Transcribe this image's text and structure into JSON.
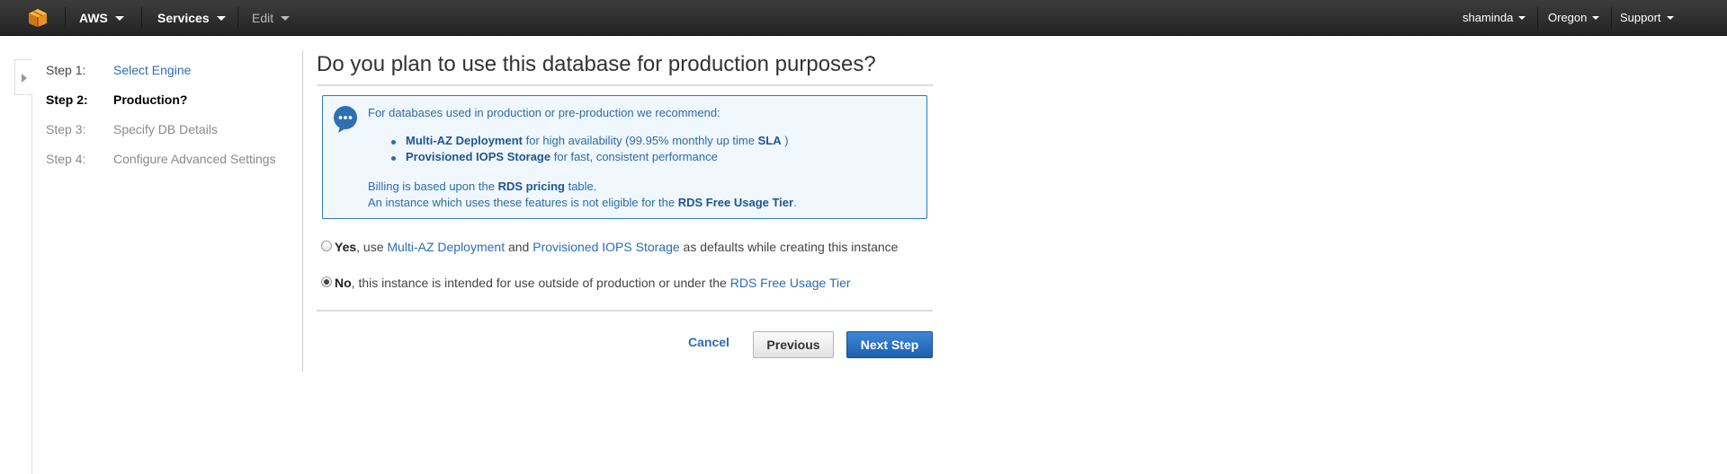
{
  "topnav": {
    "brand": "AWS",
    "services": "Services",
    "edit": "Edit",
    "user": "shaminda",
    "region": "Oregon",
    "support": "Support"
  },
  "steps": [
    {
      "num": "Step 1:",
      "label": "Select Engine",
      "state": "done"
    },
    {
      "num": "Step 2:",
      "label": "Production?",
      "state": "active"
    },
    {
      "num": "Step 3:",
      "label": "Specify DB Details",
      "state": "future"
    },
    {
      "num": "Step 4:",
      "label": "Configure Advanced Settings",
      "state": "future"
    }
  ],
  "main": {
    "title": "Do you plan to use this database for production purposes?",
    "info": {
      "intro": "For databases used in production or pre-production we recommend:",
      "bullet1_strong": "Multi-AZ Deployment",
      "bullet1_text": "for high availability (99.95% monthly up time",
      "bullet1_link": "SLA",
      "bullet1_close": ")",
      "bullet2_strong": "Provisioned IOPS Storage",
      "bullet2_text": "for fast, consistent performance",
      "billing_prefix": "Billing is based upon the",
      "billing_link": "RDS pricing",
      "billing_suffix": "table.",
      "tier_prefix": "An instance which uses these features is not eligible for the",
      "tier_link": "RDS Free Usage Tier",
      "tier_suffix": "."
    },
    "option_yes": {
      "strong": "Yes",
      "text1": ", use",
      "link1": "Multi-AZ Deployment",
      "text2": "and",
      "link2": "Provisioned IOPS Storage",
      "text3": "as defaults while creating this instance",
      "selected": false
    },
    "option_no": {
      "strong": "No",
      "text1": ", this instance is intended for use outside of production or under the",
      "link1": "RDS Free Usage Tier",
      "selected": true
    },
    "buttons": {
      "cancel": "Cancel",
      "previous": "Previous",
      "next": "Next Step"
    }
  },
  "colors": {
    "link": "#2b6db6",
    "primary_button": "#1d5fb0",
    "info_border": "#2f79b6",
    "nav_bg": "#2b2b2b"
  }
}
